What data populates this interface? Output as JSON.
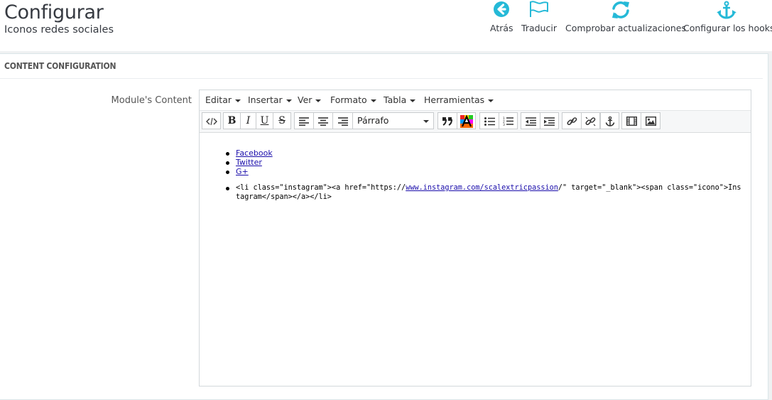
{
  "header": {
    "title": "Configurar",
    "subtitle": "Iconos redes sociales",
    "accent_color": "#25b9d7",
    "toolbar": [
      {
        "label": "Atrás",
        "icon": "arrow-circle-left-icon"
      },
      {
        "label": "Traducir",
        "icon": "flag-icon"
      },
      {
        "label": "Comprobar actualizaciones",
        "icon": "refresh-icon"
      },
      {
        "label": "Configurar los hooks",
        "icon": "anchor-icon"
      }
    ]
  },
  "panel": {
    "heading": "CONTENT CONFIGURATION",
    "field_label": "Module's Content"
  },
  "editor": {
    "menus": [
      "Editar",
      "Insertar",
      "Ver",
      "Formato",
      "Tabla",
      "Herramientas"
    ],
    "format_select": "Párrafo",
    "toolbar_icons": [
      "source-code-icon",
      "bold-icon",
      "italic-icon",
      "underline-icon",
      "strikethrough-icon",
      "align-left-icon",
      "align-center-icon",
      "align-right-icon",
      "blockquote-icon",
      "text-color-icon",
      "bullet-list-icon",
      "numbered-list-icon",
      "outdent-icon",
      "indent-icon",
      "link-icon",
      "unlink-icon",
      "anchor-icon",
      "media-icon",
      "image-icon"
    ],
    "links": [
      "Facebook",
      "Twitter",
      "G+"
    ],
    "code_line": {
      "before": "<li class=\"instagram\"><a href=\"https://",
      "link": "www.instagram.com/scalextricpassion",
      "after": "/\" target=\"_blank\"><span class=\"icono\">Instagram</span></a></li>"
    }
  }
}
